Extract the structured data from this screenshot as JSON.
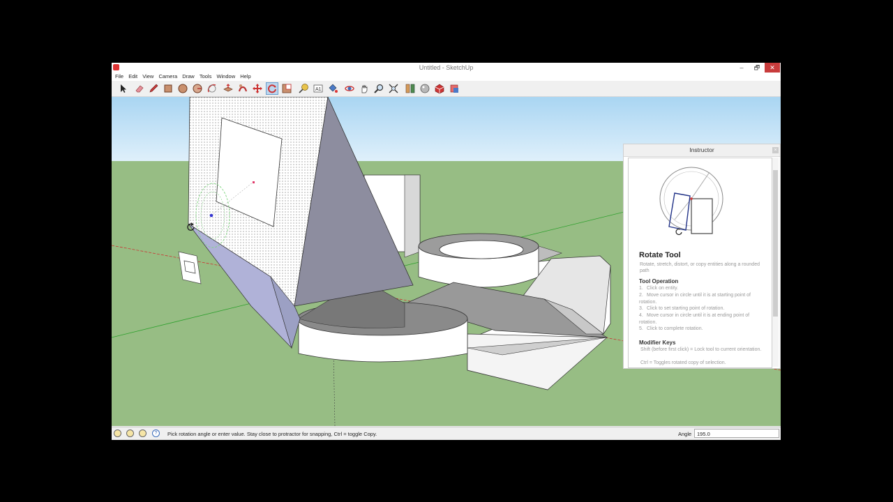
{
  "window": {
    "title": "Untitled - SketchUp",
    "min_glyph": "–",
    "max_glyph": "🗗",
    "close_glyph": "✕"
  },
  "menu": {
    "items": [
      "File",
      "Edit",
      "View",
      "Camera",
      "Draw",
      "Tools",
      "Window",
      "Help"
    ]
  },
  "toolbar": {
    "tools": [
      "select",
      "eraser",
      "pencil",
      "rectangle",
      "circle",
      "arc",
      "protractor",
      "push-pull",
      "follow-me",
      "move",
      "rotate",
      "scale",
      "tape-measure",
      "text",
      "paint-bucket",
      "orbit",
      "pan",
      "zoom",
      "zoom-extents",
      "components",
      "styles",
      "3d-warehouse",
      "extension-warehouse"
    ],
    "active_tool": "rotate"
  },
  "instructor": {
    "header": "Instructor",
    "tool_name": "Rotate Tool",
    "description": "Rotate, stretch, distort, or copy entities along a rounded path",
    "operation_heading": "Tool Operation",
    "steps": [
      {
        "num": "1.",
        "text": "Click on entity."
      },
      {
        "num": "2.",
        "text": "Move cursor in circle until it is at starting point of rotation."
      },
      {
        "num": "3.",
        "text": "Click to set starting point of rotation."
      },
      {
        "num": "4.",
        "text": "Move cursor in circle until it is at ending point of rotation."
      },
      {
        "num": "5.",
        "text": "Click to complete rotation."
      }
    ],
    "modifier_heading": "Modifier Keys",
    "modifiers": [
      "Shift (before first click) = Lock tool to current orientation.",
      "Ctrl = Toggles rotated copy of selection."
    ]
  },
  "status": {
    "message": "Pick rotation angle or enter value.  Stay close to protractor for snapping, Ctrl = toggle Copy.",
    "measure_label": "Angle",
    "measure_value": "195.0"
  },
  "colors": {
    "sky": "#b6dcf5",
    "ground": "#97bd84",
    "accent_red": "#c83c3c",
    "active_tool": "#bcd6ee"
  }
}
